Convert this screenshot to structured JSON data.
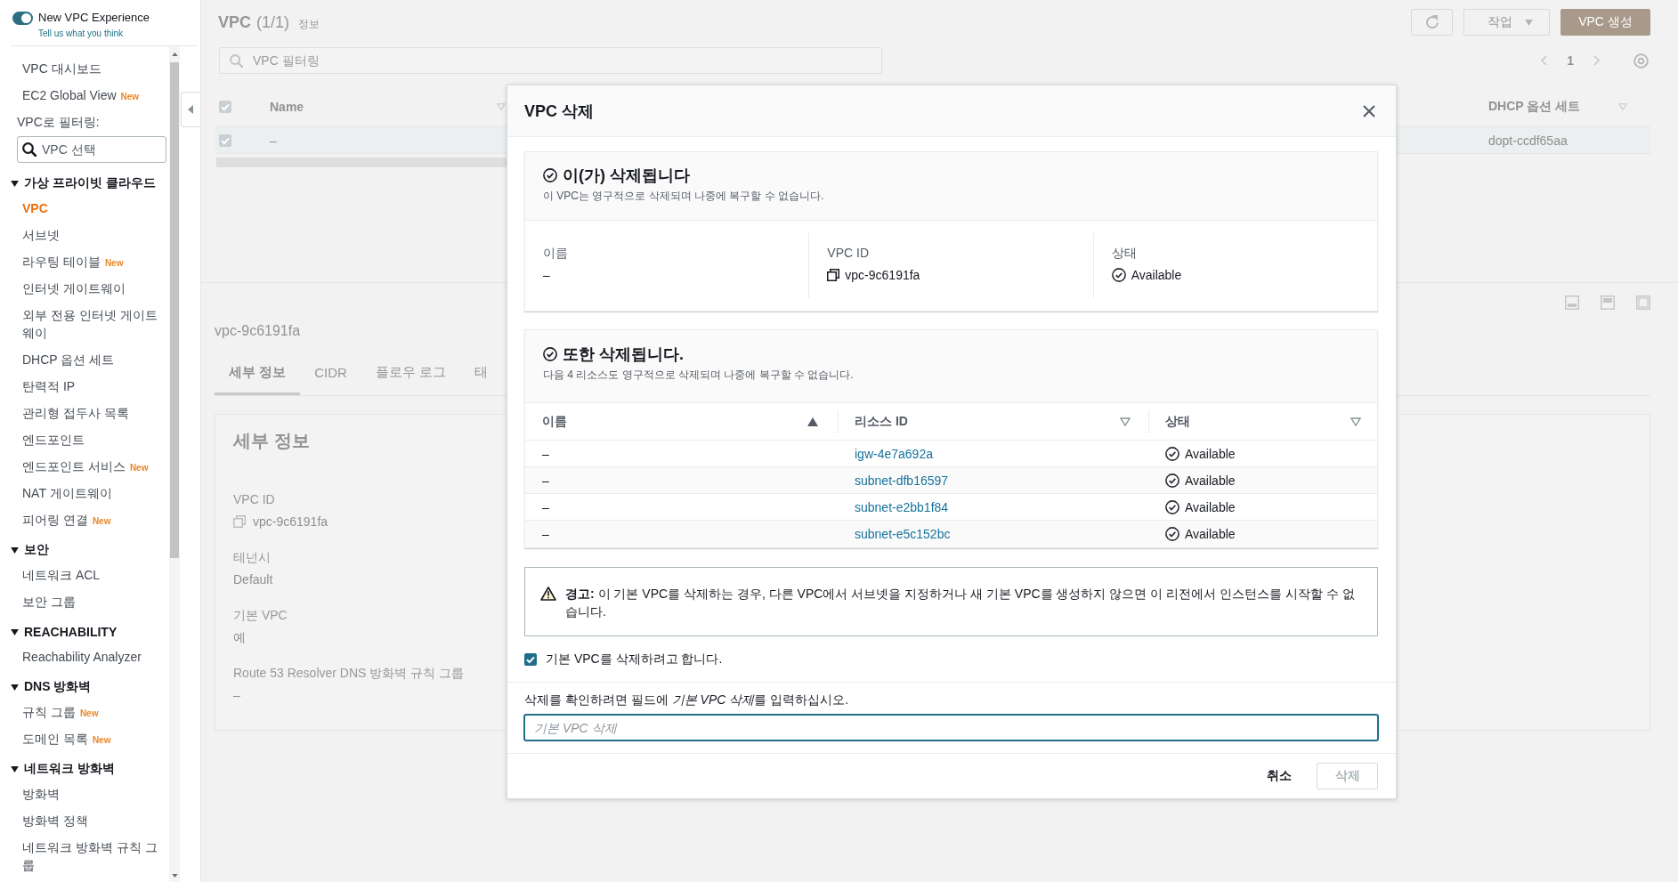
{
  "sidebar": {
    "toggle": {
      "label": "New VPC Experience",
      "on": true
    },
    "feedback_link": "Tell us what you think",
    "links": [
      {
        "label": "VPC 대시보드",
        "selected": false
      },
      {
        "label": "EC2 Global View",
        "badge": "New",
        "selected": false
      }
    ],
    "filter": {
      "label": "VPC로 필터링:",
      "placeholder": "VPC 선택"
    },
    "sections": [
      {
        "title": "가상 프라이빗 클라우드",
        "expanded": true,
        "items": [
          {
            "label": "VPC",
            "selected": true
          },
          {
            "label": "서브넷",
            "selected": false
          },
          {
            "label": "라우팅 테이블",
            "badge": "New",
            "selected": false
          },
          {
            "label": "인터넷 게이트웨이",
            "selected": false
          },
          {
            "label": "외부 전용 인터넷 게이트웨이",
            "selected": false
          },
          {
            "label": "DHCP 옵션 세트",
            "selected": false
          },
          {
            "label": "탄력적 IP",
            "selected": false
          },
          {
            "label": "관리형 접두사 목록",
            "selected": false
          },
          {
            "label": "엔드포인트",
            "selected": false
          },
          {
            "label": "엔드포인트 서비스",
            "badge": "New",
            "selected": false
          },
          {
            "label": "NAT 게이트웨이",
            "selected": false
          },
          {
            "label": "피어링 연결",
            "badge": "New",
            "selected": false
          }
        ]
      },
      {
        "title": "보안",
        "expanded": true,
        "items": [
          {
            "label": "네트워크 ACL",
            "selected": false
          },
          {
            "label": "보안 그룹",
            "selected": false
          }
        ]
      },
      {
        "title": "REACHABILITY",
        "expanded": true,
        "items": [
          {
            "label": "Reachability Analyzer",
            "selected": false
          }
        ]
      },
      {
        "title": "DNS 방화벽",
        "expanded": true,
        "items": [
          {
            "label": "규칙 그룹",
            "badge": "New",
            "selected": false
          },
          {
            "label": "도메인 목록",
            "badge": "New",
            "selected": false
          }
        ]
      },
      {
        "title": "네트워크 방화벽",
        "expanded": true,
        "items": [
          {
            "label": "방화벽",
            "selected": false
          },
          {
            "label": "방화벽 정책",
            "selected": false
          },
          {
            "label": "네트워크 방화벽 규칙 그룹",
            "selected": false
          }
        ]
      }
    ]
  },
  "vpc_list": {
    "title": "VPC",
    "count": "(1/1)",
    "info_link": "정보",
    "actions_button": "작업",
    "create_button": "VPC 생성",
    "search": {
      "placeholder": "VPC 필터링"
    },
    "pagination": {
      "page": "1"
    },
    "table": {
      "select_all": true,
      "columns": [
        {
          "label": "Name"
        },
        {
          "label": "DHCP 옵션 세트"
        }
      ],
      "rows": [
        {
          "selected": true,
          "cells": [
            "–",
            "dopt-ccdf65aa"
          ]
        }
      ]
    }
  },
  "vpc_details": {
    "title": "vpc-9c6191fa",
    "tabs": [
      {
        "label": "세부 정보",
        "selected": true
      },
      {
        "label": "CIDR",
        "selected": false
      },
      {
        "label": "플로우 로그",
        "selected": false
      },
      {
        "label": "태",
        "selected": false
      }
    ],
    "heading": "세부 정보",
    "fields": [
      {
        "label": "VPC ID",
        "value": "vpc-9c6191fa",
        "kind": "copy"
      },
      {
        "label": "테넌시",
        "value": "Default",
        "kind": "text"
      },
      {
        "label": "기본 VPC",
        "value": "예",
        "kind": "text"
      },
      {
        "label": "Route 53 Resolver DNS 방화벽 규칙 그룹",
        "value": "–",
        "kind": "text"
      }
    ]
  },
  "modal": {
    "title": "VPC 삭제",
    "target": {
      "title": "이(가) 삭제됩니다",
      "description": "이 VPC는 영구적으로 삭제되며 나중에 복구할 수 없습니다.",
      "fields": [
        {
          "label": "이름",
          "value": "–",
          "kind": "text"
        },
        {
          "label": "VPC ID",
          "value": "vpc-9c6191fa",
          "kind": "copy"
        },
        {
          "label": "상태",
          "value": "Available",
          "kind": "status"
        }
      ]
    },
    "related": {
      "title": "또한 삭제됩니다.",
      "description": "다음 4 리소스도 영구적으로 삭제되며 나중에 복구할 수 없습니다.",
      "columns": [
        {
          "label": "이름",
          "sorted": true
        },
        {
          "label": "리소스 ID",
          "sorted": false
        },
        {
          "label": "상태",
          "sorted": false
        }
      ],
      "rows": [
        {
          "name": "–",
          "resource_id": "igw-4e7a692a",
          "status": "Available"
        },
        {
          "name": "–",
          "resource_id": "subnet-dfb16597",
          "status": "Available"
        },
        {
          "name": "–",
          "resource_id": "subnet-e2bb1f84",
          "status": "Available"
        },
        {
          "name": "–",
          "resource_id": "subnet-e5c152bc",
          "status": "Available"
        }
      ]
    },
    "warning": "**경고:** 이 기본 VPC를 삭제하는 경우, 다른 VPC에서 서브넷을 지정하거나 새 기본 VPC를 생성하지 않으면 이 리전에서 인스턴스를 시작할 수 없습니다.",
    "acknowledge": {
      "label": "기본 VPC를 삭제하려고 합니다.",
      "checked": true
    },
    "confirm": {
      "instruction": "삭제를 확인하려면 필드에",
      "phrase": "기본 VPC 삭제",
      "instruction_end": "를 입력하십시오.",
      "placeholder": "기본 VPC 삭제"
    },
    "buttons": [
      {
        "label": "취소",
        "kind": "link",
        "disabled": false
      },
      {
        "label": "삭제",
        "kind": "primary",
        "disabled": true
      }
    ]
  }
}
